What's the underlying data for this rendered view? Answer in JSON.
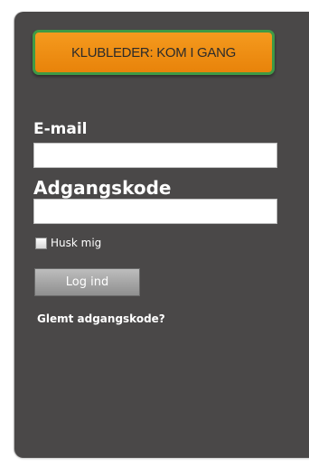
{
  "cta": {
    "label": "KLUBLEDER: KOM I GANG"
  },
  "login": {
    "email_label": "E-mail",
    "email_value": "",
    "password_label": "Adgangskode",
    "password_value": "",
    "remember_label": "Husk mig",
    "remember_checked": false,
    "submit_label": "Log ind",
    "forgot_label": "Glemt adgangskode?"
  },
  "colors": {
    "panel_background": "#4a4848",
    "cta_orange": "#f08f14",
    "cta_border": "#3f9a45",
    "text": "#ffffff"
  }
}
